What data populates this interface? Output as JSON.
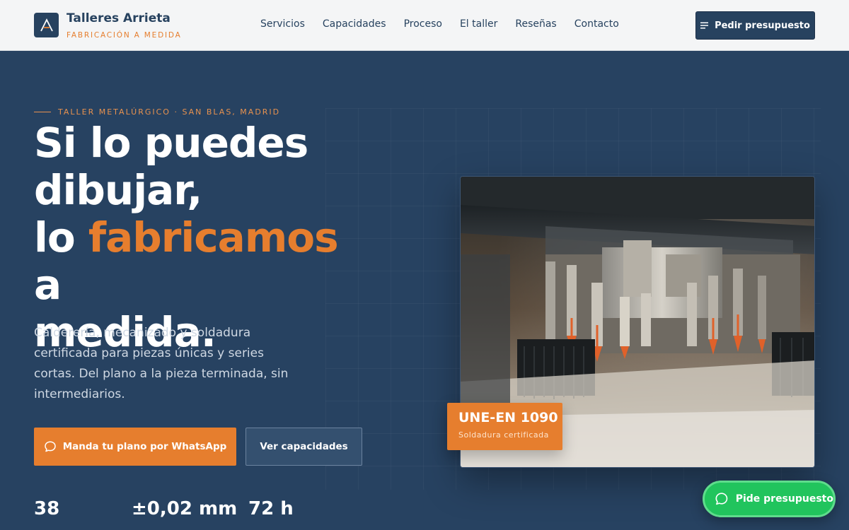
{
  "brand": {
    "name": "Talleres Arrieta",
    "tagline": "FABRICACIÓN A MEDIDA",
    "logo_icon": "a-monogram-icon"
  },
  "nav": {
    "items": [
      {
        "label": "Servicios"
      },
      {
        "label": "Capacidades"
      },
      {
        "label": "Proceso"
      },
      {
        "label": "El taller"
      },
      {
        "label": "Reseñas"
      },
      {
        "label": "Contacto"
      }
    ],
    "cta_label": "Pedir presupuesto",
    "cta_icon": "menu-lines-icon"
  },
  "hero": {
    "eyebrow": "TALLER METALÚRGICO · SAN BLAS, MADRID",
    "headline_line1": "Si lo puedes",
    "headline_line2": "dibujar,",
    "headline_line3_pre": "lo ",
    "headline_accent": "fabricamos",
    "headline_line3_post": " a",
    "headline_line4": "medida.",
    "lead": "Calderería, mecanizado y soldadura certificada para piezas únicas y series cortas. Del plano a la pieza terminada, sin intermediarios.",
    "primary_button": "Manda tu plano por WhatsApp",
    "primary_icon": "chat-bubble-icon",
    "secondary_button": "Ver capacidades",
    "stats": [
      {
        "value": "38"
      },
      {
        "value": "±0,02 mm"
      },
      {
        "value": "72 h"
      }
    ]
  },
  "badge": {
    "title": "UNE-EN 1090",
    "subtitle": "Soldadura certificada"
  },
  "floating_whatsapp": {
    "label": "Pide presupuesto",
    "icon": "whatsapp-icon"
  },
  "colors": {
    "navy": "#274261",
    "accent": "#e67e2e",
    "header_bg": "#f4f5f6",
    "whatsapp_green": "#21c45d"
  }
}
